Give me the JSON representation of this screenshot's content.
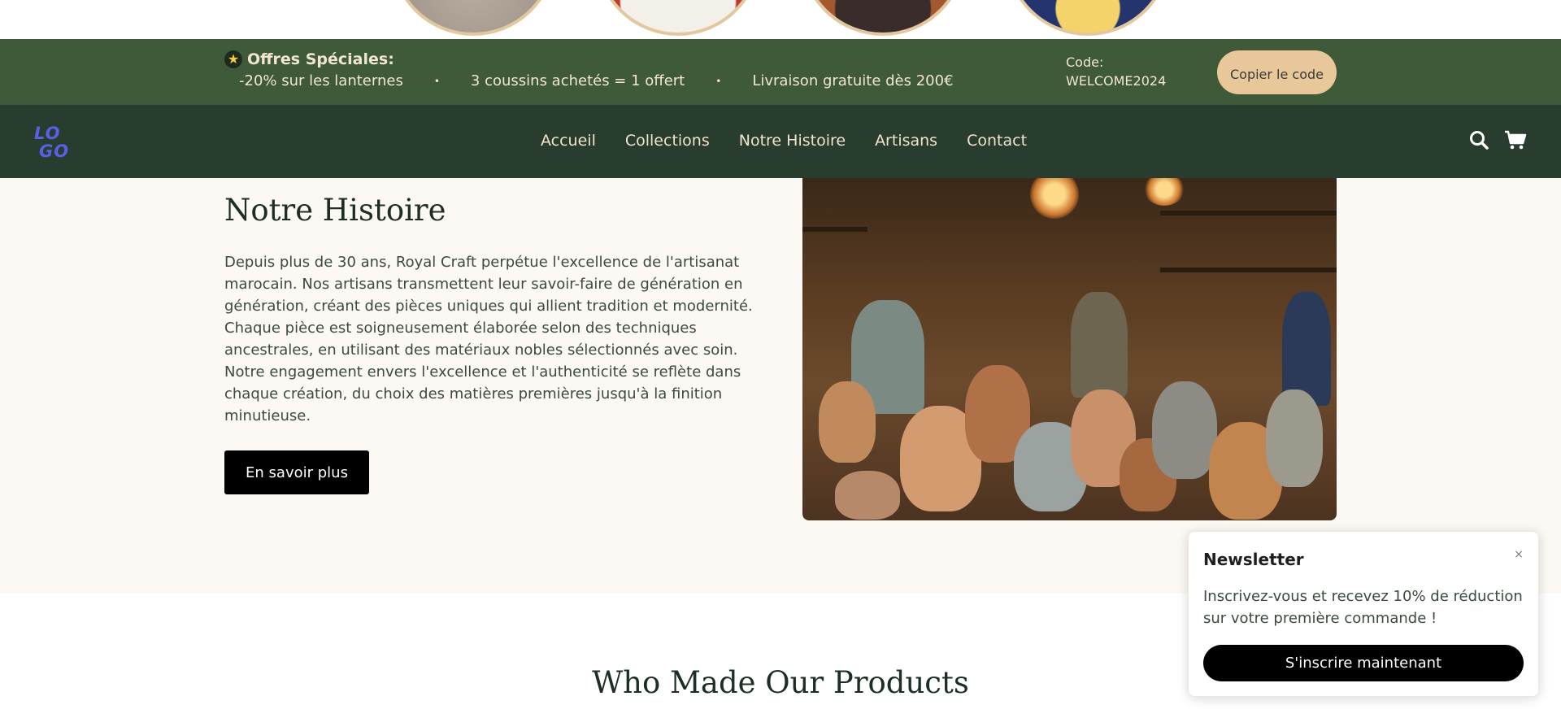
{
  "promo": {
    "title": "Offres Spéciales:",
    "items": [
      "-20% sur les lanternes",
      "3 coussins achetés = 1 offert",
      "Livraison gratuite dès 200€"
    ],
    "separator": "•",
    "code_text": "Code: WELCOME2024",
    "copy_label": "Copier le code",
    "icon": "star-icon"
  },
  "nav": {
    "logo": "LOGO",
    "links": [
      "Accueil",
      "Collections",
      "Notre Histoire",
      "Artisans",
      "Contact"
    ],
    "icons": [
      "search-icon",
      "cart-icon"
    ]
  },
  "histoire": {
    "title": "Notre Histoire",
    "text": "Depuis plus de 30 ans, Royal Craft perpétue l'excellence de l'artisanat marocain. Nos artisans transmettent leur savoir-faire de génération en génération, créant des pièces uniques qui allient tradition et modernité. Chaque pièce est soigneusement élaborée selon des techniques ancestrales, en utilisant des matériaux nobles sélectionnés avec soin. Notre engagement envers l'excellence et l'authenticité se reflète dans chaque création, du choix des matières premières jusqu'à la finition minutieuse.",
    "button": "En savoir plus"
  },
  "who": {
    "title": "Who Made Our Products"
  },
  "newsletter": {
    "title": "Newsletter",
    "close": "×",
    "text": "Inscrivez-vous et recevez 10% de réduction sur votre première commande !",
    "button": "S'inscrire maintenant"
  },
  "colors": {
    "promo_bg": "#3f5a38",
    "nav_bg": "#283d2e",
    "accent": "#e8c89a",
    "logo": "#5860e8"
  }
}
